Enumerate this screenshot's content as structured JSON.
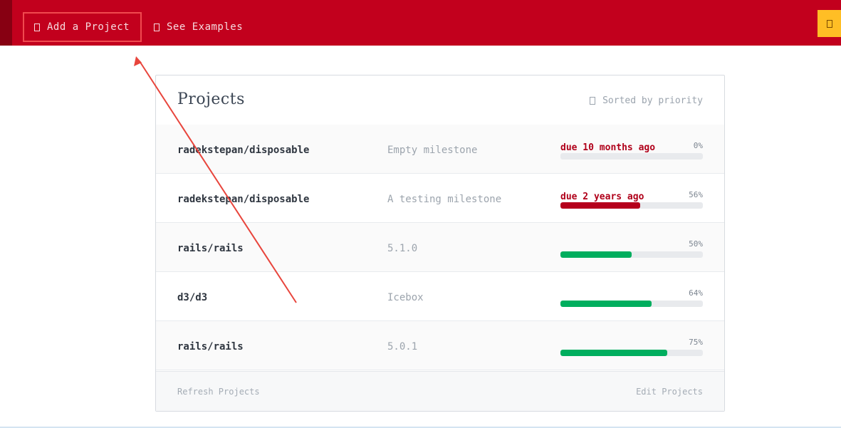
{
  "topbar": {
    "add_project_label": "Add a Project",
    "see_examples_label": "See Examples",
    "accent_color": "#c2001d",
    "right_button_color": "#ffbe25"
  },
  "panel": {
    "title": "Projects",
    "sort_label": "Sorted by priority",
    "rows": [
      {
        "repo": "radekstepan/disposable",
        "milestone": "Empty milestone",
        "due": "due 10 months ago",
        "percent_label": "0%",
        "progress": 0,
        "bar_color": "#b5001c"
      },
      {
        "repo": "radekstepan/disposable",
        "milestone": "A testing milestone",
        "due": "due 2 years ago",
        "percent_label": "56%",
        "progress": 56,
        "bar_color": "#b5001c"
      },
      {
        "repo": "rails/rails",
        "milestone": "5.1.0",
        "due": "",
        "percent_label": "50%",
        "progress": 50,
        "bar_color": "#00ae5e"
      },
      {
        "repo": "d3/d3",
        "milestone": "Icebox",
        "due": "",
        "percent_label": "64%",
        "progress": 64,
        "bar_color": "#00ae5e"
      },
      {
        "repo": "rails/rails",
        "milestone": "5.0.1",
        "due": "",
        "percent_label": "75%",
        "progress": 75,
        "bar_color": "#00ae5e"
      }
    ],
    "footer": {
      "refresh_label": "Refresh Projects",
      "edit_label": "Edit Projects"
    }
  },
  "annotation": {
    "arrow_color": "#e8453c"
  }
}
